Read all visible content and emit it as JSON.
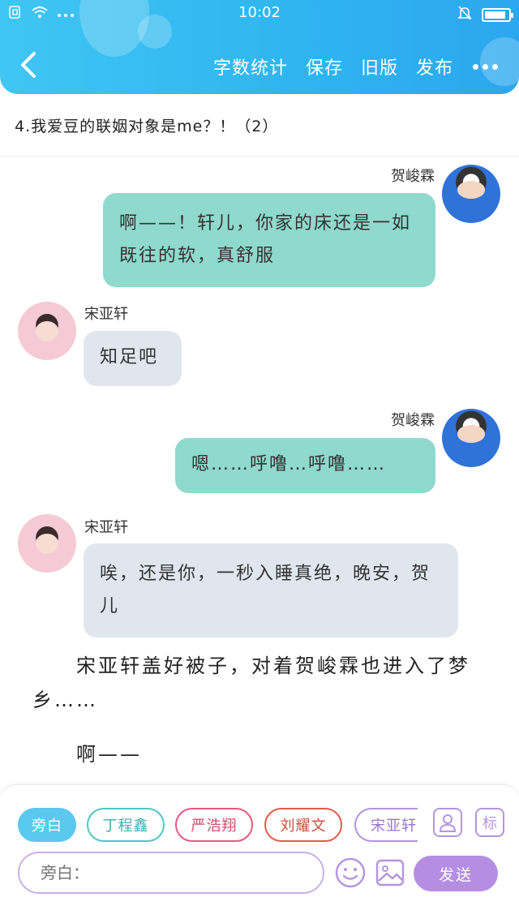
{
  "status_bar": {
    "time": "10:02",
    "left_icons": [
      "sim-icon",
      "wifi-icon",
      "more-dots-icon"
    ],
    "right_icons": [
      "bell-muted-icon",
      "battery-icon"
    ],
    "battery_level": 0.9
  },
  "header": {
    "back_icon": "chevron-left-icon",
    "actions": [
      "字数统计",
      "保存",
      "旧版",
      "发布"
    ],
    "more_icon": "more-horizontal-icon"
  },
  "chapter": {
    "title": "4.我爱豆的联姻对象是me？！（2）"
  },
  "messages": [
    {
      "speaker": "贺峻霖",
      "side": "right",
      "text": "啊——！轩儿，你家的床还是一如既往的软，真舒服"
    },
    {
      "speaker": "宋亚轩",
      "side": "left",
      "text": "知足吧"
    },
    {
      "speaker": "贺峻霖",
      "side": "right",
      "text": "嗯……呼噜…呼噜……"
    },
    {
      "speaker": "宋亚轩",
      "side": "left",
      "text": "唉，还是你，一秒入睡真绝，晚安，贺儿"
    }
  ],
  "narration": [
    "宋亚轩盖好被子，对着贺峻霖也进入了梦乡……",
    "啊——"
  ],
  "composer": {
    "roles": [
      "旁白",
      "丁程鑫",
      "严浩翔",
      "刘耀文",
      "宋亚轩"
    ],
    "active_role": "旁白",
    "role_colors": [
      "#5bc8ef",
      "#4fc7c4",
      "#e8587e",
      "#e25b4b",
      "#b594e0"
    ],
    "person_icon": "person-card-icon",
    "tag_label": "标",
    "input_placeholder": "旁白：",
    "emoji_icon": "emoji-icon",
    "image_icon": "image-icon",
    "send_label": "发送"
  },
  "colors": {
    "header": "#30b5f0",
    "bubble_right": "#8fd9cd",
    "bubble_left": "#dfe6ee",
    "accent_purple": "#b58ee3"
  }
}
